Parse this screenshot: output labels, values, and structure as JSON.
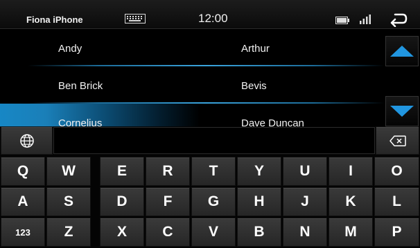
{
  "status_bar": {
    "device_name": "Fiona iPhone",
    "time": "12:00",
    "icons": [
      "keyboard-icon",
      "battery-icon",
      "signal-icon",
      "back-arrow-icon"
    ]
  },
  "contacts": {
    "rows": [
      [
        "Andy",
        "Arthur"
      ],
      [
        "Ben Brick",
        "Bevis"
      ],
      [
        "Cornelius",
        "Dave Duncan"
      ]
    ],
    "selected_row": 2
  },
  "scroll": {
    "up_icon": "triangle-up-icon",
    "down_icon": "triangle-down-icon"
  },
  "keyboard": {
    "input_value": "",
    "row1": [
      "Q",
      "W",
      "E",
      "R",
      "T",
      "Y",
      "U",
      "I",
      "O"
    ],
    "row2": [
      "A",
      "S",
      "D",
      "F",
      "G",
      "H",
      "J",
      "K",
      "L"
    ],
    "row3": [
      "123",
      "Z",
      "X",
      "C",
      "V",
      "B",
      "N",
      "M",
      "P"
    ],
    "globe_icon": "globe-icon",
    "backspace_icon": "backspace-icon"
  },
  "colors": {
    "accent": "#2196e0",
    "selection": "#1787c5",
    "key_background": "#333333",
    "background": "#000000"
  }
}
